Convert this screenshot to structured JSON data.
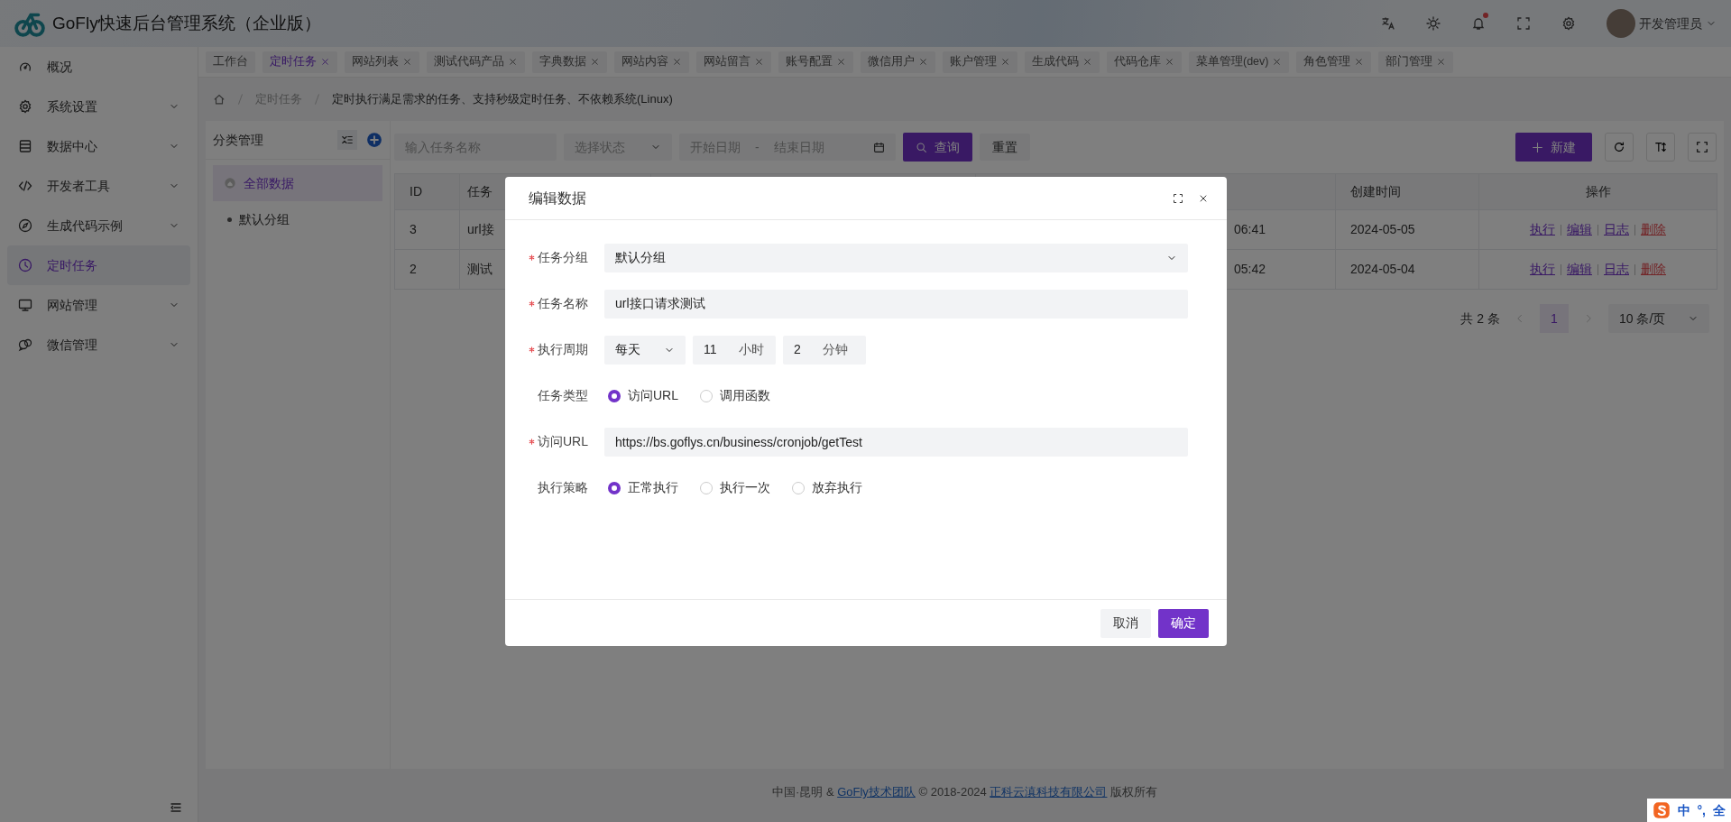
{
  "header": {
    "title": "GoFly快速后台管理系统（企业版）",
    "has_unread": true,
    "user": "开发管理员"
  },
  "sidebar": {
    "items": [
      {
        "label": "概况",
        "selected": false,
        "expandable": false
      },
      {
        "label": "系统设置",
        "selected": false,
        "expandable": true
      },
      {
        "label": "数据中心",
        "selected": false,
        "expandable": true
      },
      {
        "label": "开发者工具",
        "selected": false,
        "expandable": true
      },
      {
        "label": "生成代码示例",
        "selected": false,
        "expandable": true
      },
      {
        "label": "定时任务",
        "selected": true,
        "expandable": false
      },
      {
        "label": "网站管理",
        "selected": false,
        "expandable": true
      },
      {
        "label": "微信管理",
        "selected": false,
        "expandable": true
      }
    ]
  },
  "tabs": [
    {
      "label": "工作台",
      "selected": false,
      "closable": false
    },
    {
      "label": "定时任务",
      "selected": true,
      "closable": true
    },
    {
      "label": "网站列表",
      "selected": false,
      "closable": true
    },
    {
      "label": "测试代码产品",
      "selected": false,
      "closable": true
    },
    {
      "label": "字典数据",
      "selected": false,
      "closable": true
    },
    {
      "label": "网站内容",
      "selected": false,
      "closable": true
    },
    {
      "label": "网站留言",
      "selected": false,
      "closable": true
    },
    {
      "label": "账号配置",
      "selected": false,
      "closable": true
    },
    {
      "label": "微信用户",
      "selected": false,
      "closable": true
    },
    {
      "label": "账户管理",
      "selected": false,
      "closable": true
    },
    {
      "label": "生成代码",
      "selected": false,
      "closable": true
    },
    {
      "label": "代码仓库",
      "selected": false,
      "closable": true
    },
    {
      "label": "菜单管理(dev)",
      "selected": false,
      "closable": true
    },
    {
      "label": "角色管理",
      "selected": false,
      "closable": true
    },
    {
      "label": "部门管理",
      "selected": false,
      "closable": true
    }
  ],
  "breadcrumb": [
    "定时任务",
    "定时执行满足需求的任务、支持秒级定时任务、不依赖系统(Linux)"
  ],
  "category_panel": {
    "title": "分类管理",
    "items": [
      {
        "label": "全部数据",
        "selected": true
      },
      {
        "label": "默认分组",
        "selected": false
      }
    ]
  },
  "filters": {
    "name_placeholder": "输入任务名称",
    "status_placeholder": "选择状态",
    "start_placeholder": "开始日期",
    "separator": "-",
    "end_placeholder": "结束日期",
    "search_button": "查询",
    "reset_button": "重置"
  },
  "toolbar": {
    "new_button": "新建"
  },
  "table": {
    "columns": [
      "ID",
      "任务",
      "创建时间",
      "操作"
    ],
    "rows": [
      {
        "id": "3",
        "name": "url接",
        "time": "06:41",
        "created": "2024-05-05",
        "actions": [
          {
            "label": "执行",
            "kind": "normal"
          },
          {
            "label": "编辑",
            "kind": "normal"
          },
          {
            "label": "日志",
            "kind": "normal"
          },
          {
            "label": "删除",
            "kind": "danger"
          }
        ]
      },
      {
        "id": "2",
        "name": "测试",
        "time": "05:42",
        "created": "2024-05-04",
        "actions": [
          {
            "label": "执行",
            "kind": "normal"
          },
          {
            "label": "编辑",
            "kind": "normal"
          },
          {
            "label": "日志",
            "kind": "normal"
          },
          {
            "label": "删除",
            "kind": "danger"
          }
        ]
      }
    ]
  },
  "pagination": {
    "total": "共 2 条",
    "pages": [
      {
        "label": "1",
        "selected": true
      }
    ],
    "page_size": "10 条/页"
  },
  "modal": {
    "title": "编辑数据",
    "fields": [
      {
        "kind": "select",
        "label": "任务分组",
        "required": true,
        "value": "默认分组"
      },
      {
        "kind": "input",
        "label": "任务名称",
        "required": true,
        "value": "url接口请求测试"
      },
      {
        "kind": "period",
        "label": "执行周期",
        "required": true,
        "frequency": "每天",
        "hour": "11",
        "hour_unit": "小时",
        "minute": "2",
        "minute_unit": "分钟"
      },
      {
        "kind": "radio",
        "label": "任务类型",
        "required": false,
        "options": [
          {
            "label": "访问URL",
            "selected": true
          },
          {
            "label": "调用函数",
            "selected": false
          }
        ]
      },
      {
        "kind": "input",
        "label": "访问URL",
        "required": true,
        "value": "https://bs.goflys.cn/business/cronjob/getTest"
      },
      {
        "kind": "radio",
        "label": "执行策略",
        "required": false,
        "options": [
          {
            "label": "正常执行",
            "selected": true
          },
          {
            "label": "执行一次",
            "selected": false
          },
          {
            "label": "放弃执行",
            "selected": false
          }
        ]
      }
    ],
    "cancel_button": "取消",
    "confirm_button": "确定"
  },
  "footer": [
    {
      "text": "中国·昆明 & ",
      "kind": "text"
    },
    {
      "text": "GoFly技术团队",
      "kind": "link"
    },
    {
      "text": " © 2018-2024 ",
      "kind": "text"
    },
    {
      "text": "正科云滇科技有限公司",
      "kind": "link"
    },
    {
      "text": " 版权所有",
      "kind": "text"
    }
  ],
  "ime_toolbar": [
    "中",
    "°,",
    "全"
  ]
}
